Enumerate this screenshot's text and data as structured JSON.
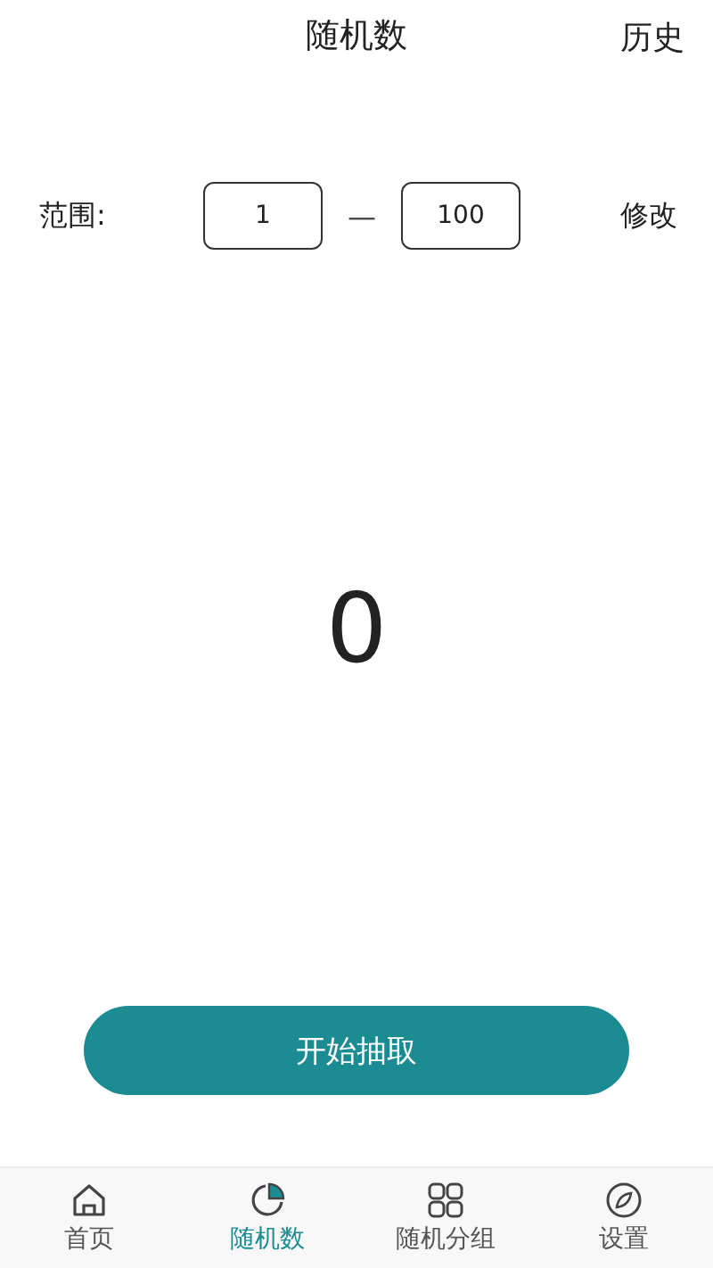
{
  "header": {
    "title": "随机数",
    "action": "历史"
  },
  "range": {
    "label": "范围:",
    "min": "1",
    "separator": "—",
    "max": "100",
    "action": "修改"
  },
  "result": "0",
  "start_button": "开始抽取",
  "tabs": [
    {
      "kind": "home",
      "label": "首页",
      "selected": false
    },
    {
      "kind": "pie",
      "label": "随机数",
      "selected": true
    },
    {
      "kind": "grid",
      "label": "随机分组",
      "selected": false
    },
    {
      "kind": "compass",
      "label": "设置",
      "selected": false
    }
  ]
}
